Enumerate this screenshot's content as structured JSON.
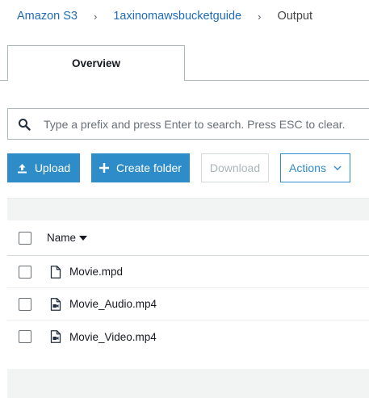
{
  "breadcrumb": {
    "items": [
      "Amazon S3",
      "1axinomawsbucketguide"
    ],
    "current": "Output",
    "separator": "›"
  },
  "tabs": [
    {
      "label": "Overview",
      "active": true
    }
  ],
  "search": {
    "placeholder": "Type a prefix and press Enter to search. Press ESC to clear.",
    "value": ""
  },
  "toolbar": {
    "upload_label": "Upload",
    "create_folder_label": "Create folder",
    "download_label": "Download",
    "actions_label": "Actions"
  },
  "table": {
    "name_header": "Name",
    "sort": "descending",
    "rows": [
      {
        "name": "Movie.mpd",
        "icon": "file-icon"
      },
      {
        "name": "Movie_Audio.mp4",
        "icon": "video-file-icon"
      },
      {
        "name": "Movie_Video.mp4",
        "icon": "video-file-icon"
      }
    ]
  },
  "colors": {
    "primary": "#2e8cc9",
    "link": "#1f6bb8",
    "band": "#f2f3f3"
  }
}
